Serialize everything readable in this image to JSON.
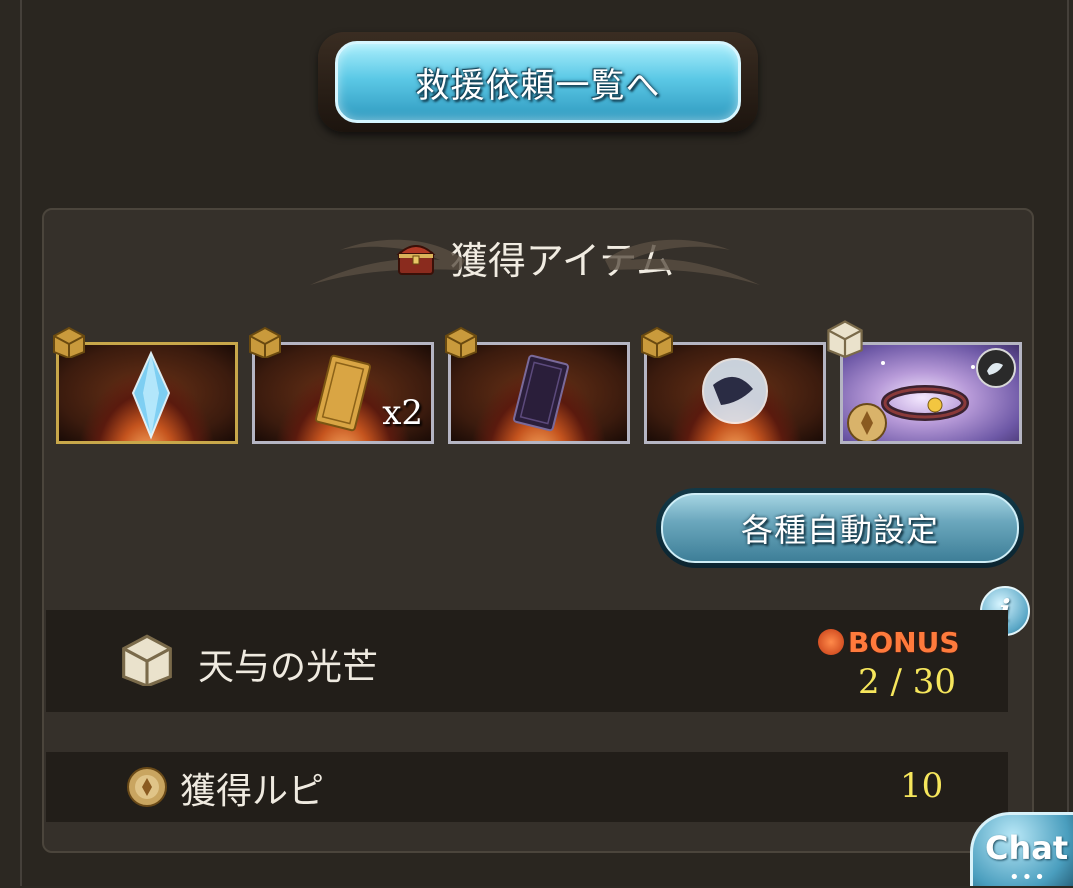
{
  "rescue_button": {
    "label": "救援依頼一覧へ"
  },
  "items_section": {
    "title": "獲得アイテム",
    "items": [
      {
        "name": "crystal-item",
        "qty_label": ""
      },
      {
        "name": "gold-card-item",
        "qty_label": "x2"
      },
      {
        "name": "dark-card-item",
        "qty_label": ""
      },
      {
        "name": "orb-item",
        "qty_label": ""
      },
      {
        "name": "bracelet-item",
        "qty_label": ""
      }
    ]
  },
  "auto_settings_button": {
    "label": "各種自動設定"
  },
  "gift_row": {
    "label": "天与の光芒",
    "bonus_label": "BONUS",
    "count": "2 / 30"
  },
  "rupie_row": {
    "label": "獲得ルピ",
    "value": "10"
  },
  "info_button": {
    "glyph": "i"
  },
  "chat_button": {
    "label": "Chat",
    "dots": "•••"
  },
  "colors": {
    "background": "#2c2822",
    "panel": "#35302a",
    "row": "#221e19",
    "accent_blue": "#5cc9e6",
    "gold_text": "#f6e65c",
    "bonus_orange": "#ff7a3c"
  }
}
